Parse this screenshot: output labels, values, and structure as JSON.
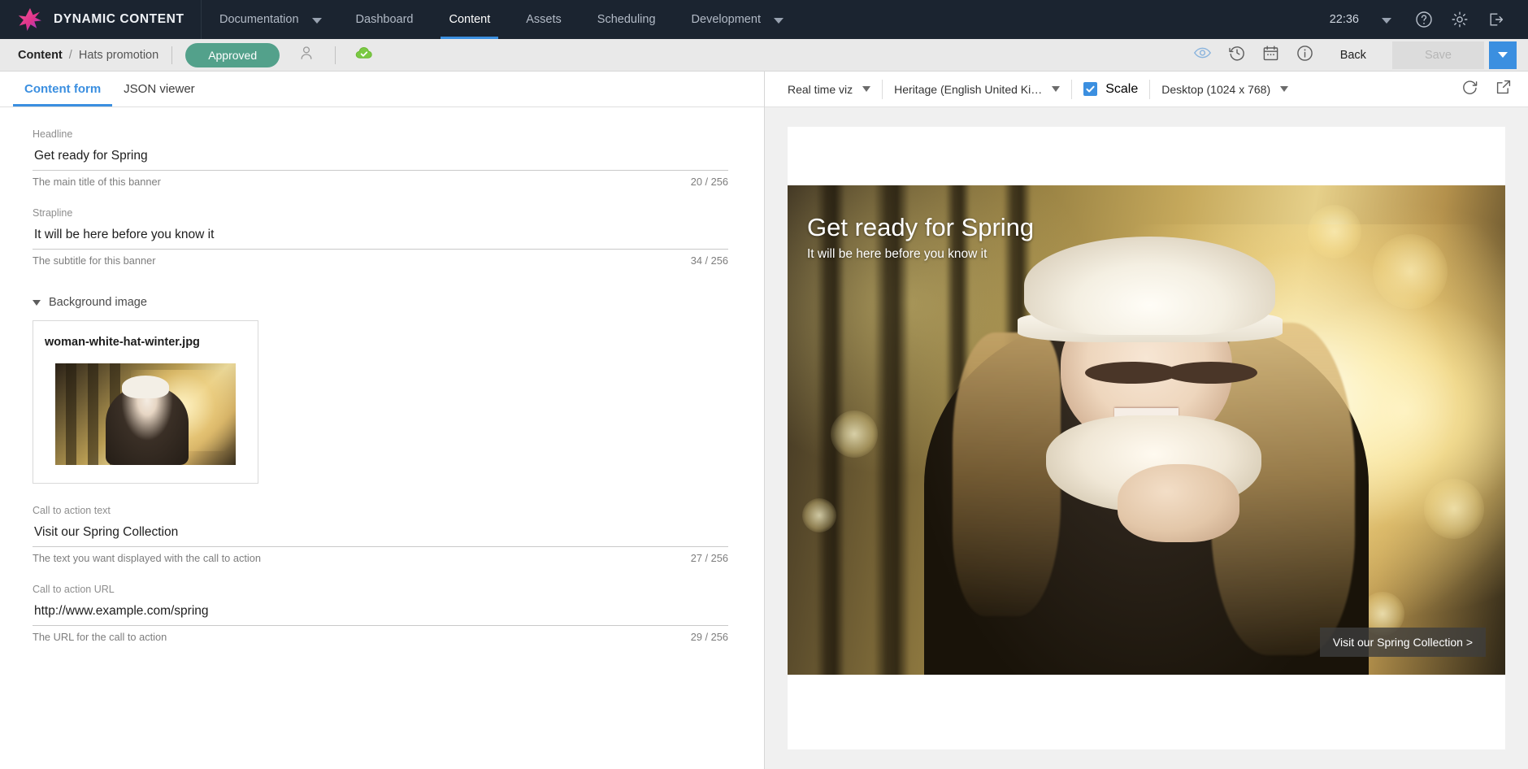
{
  "topnav": {
    "brand": "DYNAMIC CONTENT",
    "items": [
      {
        "label": "Documentation",
        "caret": true,
        "active": false
      },
      {
        "label": "Dashboard",
        "caret": false,
        "active": false
      },
      {
        "label": "Content",
        "caret": false,
        "active": true
      },
      {
        "label": "Assets",
        "caret": false,
        "active": false
      },
      {
        "label": "Scheduling",
        "caret": false,
        "active": false
      },
      {
        "label": "Development",
        "caret": false,
        "active": false
      }
    ],
    "clock": "22:36",
    "icons": [
      "chevron-down-icon",
      "help-icon",
      "gear-icon",
      "logout-icon"
    ]
  },
  "subheader": {
    "breadcrumb_root": "Content",
    "breadcrumb_sep": "/",
    "breadcrumb_leaf": "Hats promotion",
    "status": "Approved",
    "status_color": "#53a18b",
    "icons": [
      "user-icon",
      "cloud-check-icon",
      "preview-eye-icon",
      "history-icon",
      "calendar-icon",
      "info-icon"
    ],
    "back_label": "Back",
    "save_label": "Save",
    "save_disabled": true,
    "save_caret_color": "#3b8fe0"
  },
  "tabs": [
    {
      "label": "Content form",
      "active": true
    },
    {
      "label": "JSON viewer",
      "active": false
    }
  ],
  "form": {
    "fields": [
      {
        "label": "Headline",
        "value": "Get ready for Spring",
        "help": "The main title of this banner",
        "count": "20 / 256"
      },
      {
        "label": "Strapline",
        "value": "It will be here before you know it",
        "help": "The subtitle for this banner",
        "count": "34 / 256"
      }
    ],
    "section": {
      "title": "Background image",
      "media_name": "woman-white-hat-winter.jpg"
    },
    "fields2": [
      {
        "label": "Call to action text",
        "value": "Visit our Spring Collection",
        "help": "The text you want displayed with the call to action",
        "count": "27 / 256"
      },
      {
        "label": "Call to action URL",
        "value": "http://www.example.com/spring",
        "help": "The URL for the call to action",
        "count": "29 / 256"
      }
    ]
  },
  "preview": {
    "viz_label": "Real time viz",
    "locale_label": "Heritage (English United Ki…",
    "scale_label": "Scale",
    "scale_checked": true,
    "device_label": "Desktop (1024 x 768)",
    "right_icons": [
      "refresh-icon",
      "open-external-icon"
    ],
    "banner": {
      "headline": "Get ready for Spring",
      "strapline": "It will be here before you know it",
      "cta": "Visit our Spring Collection >"
    }
  }
}
